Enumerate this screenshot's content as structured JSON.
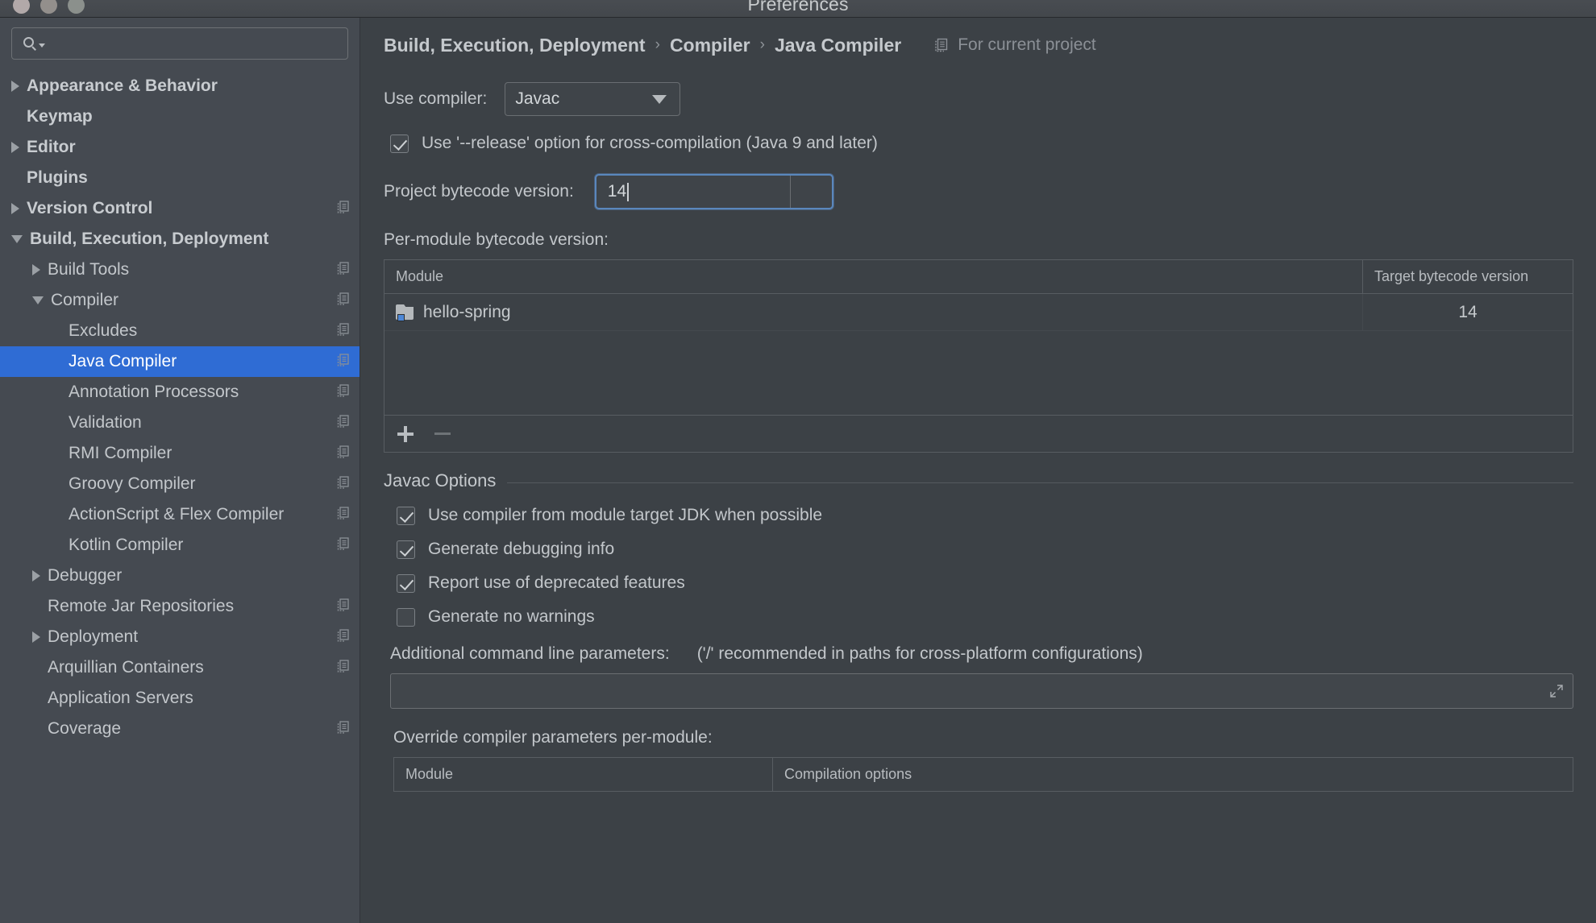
{
  "window": {
    "title": "Preferences",
    "traffic_lights": [
      "close",
      "minimize",
      "maximize"
    ]
  },
  "sidebar": {
    "search": {
      "value": "",
      "placeholder": ""
    },
    "items": [
      {
        "label": "Appearance & Behavior",
        "arrow": "collapsed",
        "indent": 0,
        "bold": true,
        "badge": false,
        "selected": false
      },
      {
        "label": "Keymap",
        "arrow": "none",
        "indent": 0,
        "bold": true,
        "badge": false,
        "selected": false
      },
      {
        "label": "Editor",
        "arrow": "collapsed",
        "indent": 0,
        "bold": true,
        "badge": false,
        "selected": false
      },
      {
        "label": "Plugins",
        "arrow": "none",
        "indent": 0,
        "bold": true,
        "badge": false,
        "selected": false
      },
      {
        "label": "Version Control",
        "arrow": "collapsed",
        "indent": 0,
        "bold": true,
        "badge": true,
        "selected": false
      },
      {
        "label": "Build, Execution, Deployment",
        "arrow": "expanded",
        "indent": 0,
        "bold": true,
        "badge": false,
        "selected": false
      },
      {
        "label": "Build Tools",
        "arrow": "collapsed",
        "indent": 1,
        "bold": false,
        "badge": true,
        "selected": false
      },
      {
        "label": "Compiler",
        "arrow": "expanded",
        "indent": 1,
        "bold": false,
        "badge": true,
        "selected": false
      },
      {
        "label": "Excludes",
        "arrow": "none",
        "indent": 2,
        "bold": false,
        "badge": true,
        "selected": false
      },
      {
        "label": "Java Compiler",
        "arrow": "none",
        "indent": 2,
        "bold": false,
        "badge": true,
        "selected": true
      },
      {
        "label": "Annotation Processors",
        "arrow": "none",
        "indent": 2,
        "bold": false,
        "badge": true,
        "selected": false
      },
      {
        "label": "Validation",
        "arrow": "none",
        "indent": 2,
        "bold": false,
        "badge": true,
        "selected": false
      },
      {
        "label": "RMI Compiler",
        "arrow": "none",
        "indent": 2,
        "bold": false,
        "badge": true,
        "selected": false
      },
      {
        "label": "Groovy Compiler",
        "arrow": "none",
        "indent": 2,
        "bold": false,
        "badge": true,
        "selected": false
      },
      {
        "label": "ActionScript & Flex Compiler",
        "arrow": "none",
        "indent": 2,
        "bold": false,
        "badge": true,
        "selected": false
      },
      {
        "label": "Kotlin Compiler",
        "arrow": "none",
        "indent": 2,
        "bold": false,
        "badge": true,
        "selected": false
      },
      {
        "label": "Debugger",
        "arrow": "collapsed",
        "indent": 1,
        "bold": false,
        "badge": false,
        "selected": false
      },
      {
        "label": "Remote Jar Repositories",
        "arrow": "none",
        "indent": 1,
        "bold": false,
        "badge": true,
        "selected": false
      },
      {
        "label": "Deployment",
        "arrow": "collapsed",
        "indent": 1,
        "bold": false,
        "badge": true,
        "selected": false
      },
      {
        "label": "Arquillian Containers",
        "arrow": "none",
        "indent": 1,
        "bold": false,
        "badge": true,
        "selected": false
      },
      {
        "label": "Application Servers",
        "arrow": "none",
        "indent": 1,
        "bold": false,
        "badge": false,
        "selected": false
      },
      {
        "label": "Coverage",
        "arrow": "none",
        "indent": 1,
        "bold": false,
        "badge": true,
        "selected": false
      }
    ]
  },
  "main": {
    "breadcrumb": {
      "items": [
        "Build, Execution, Deployment",
        "Compiler",
        "Java Compiler"
      ],
      "separator": "›",
      "scope_label": "For current project"
    },
    "use_compiler": {
      "label": "Use compiler:",
      "value": "Javac"
    },
    "release_option": {
      "label": "Use '--release' option for cross-compilation (Java 9 and later)",
      "checked": true
    },
    "project_bytecode": {
      "label": "Project bytecode version:",
      "value": "14",
      "focused": true
    },
    "per_module": {
      "label": "Per-module bytecode version:",
      "columns": [
        "Module",
        "Target bytecode version"
      ],
      "rows": [
        {
          "module": "hello-spring",
          "version": "14"
        }
      ],
      "toolbar": {
        "add": "+",
        "remove": "−"
      }
    },
    "javac_options": {
      "title": "Javac Options",
      "checkboxes": [
        {
          "label": "Use compiler from module target JDK when possible",
          "checked": true
        },
        {
          "label": "Generate debugging info",
          "checked": true
        },
        {
          "label": "Report use of deprecated features",
          "checked": true
        },
        {
          "label": "Generate no warnings",
          "checked": false
        }
      ],
      "additional": {
        "label": "Additional command line parameters:",
        "hint": "('/' recommended in paths for cross-platform configurations)",
        "value": ""
      },
      "override": {
        "label": "Override compiler parameters per-module:",
        "columns": [
          "Module",
          "Compilation options"
        ]
      }
    }
  },
  "colors": {
    "accent_selection": "#2f6cd4",
    "focus_ring": "#5a87bd",
    "panel_bg": "#3c4146",
    "sidebar_bg": "#454a51",
    "text": "#c3c7cb",
    "muted_text": "#8b9096"
  }
}
